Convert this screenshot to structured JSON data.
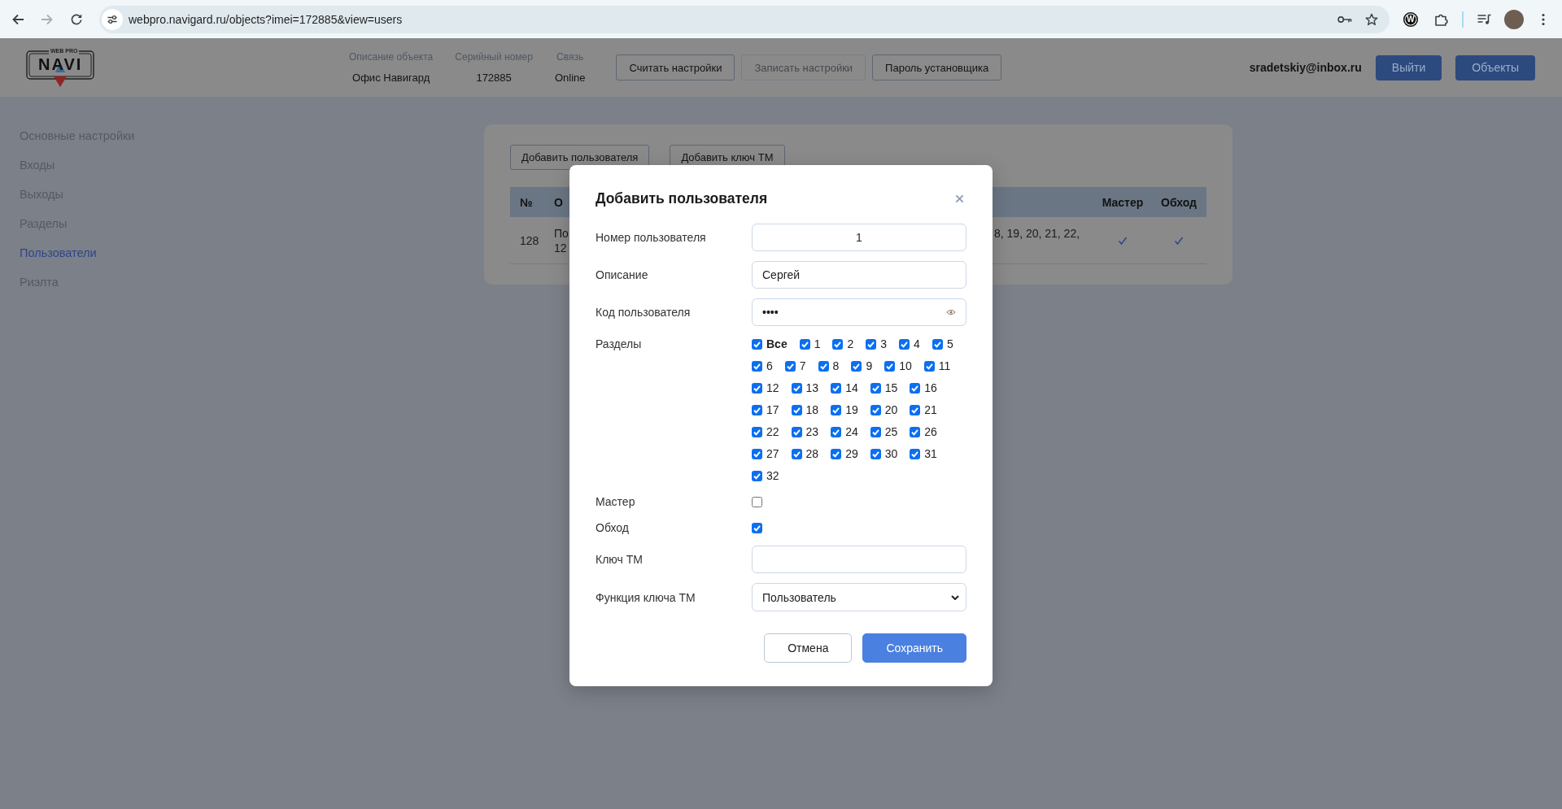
{
  "browser": {
    "url": "webpro.navigard.ru/objects?imei=172885&view=users",
    "forward_disabled": true,
    "extension_letter": "W"
  },
  "header": {
    "logo": {
      "caption": "WEB PRO",
      "wordmark": "NAVI"
    },
    "info": [
      {
        "label": "Описание объекта",
        "value": "Офис Навигард"
      },
      {
        "label": "Серийный номер",
        "value": "172885"
      },
      {
        "label": "Связь",
        "value": "Online"
      }
    ],
    "actions": [
      {
        "label": "Считать настройки",
        "disabled": false
      },
      {
        "label": "Записать настройки",
        "disabled": true
      },
      {
        "label": "Пароль установщика",
        "disabled": false
      }
    ],
    "user_email": "sradetskiy@inbox.ru",
    "buttons": [
      "Выйти",
      "Объекты"
    ]
  },
  "sidebar": {
    "items": [
      {
        "label": "Основные настройки",
        "selected": false
      },
      {
        "label": "Входы",
        "selected": false
      },
      {
        "label": "Выходы",
        "selected": false
      },
      {
        "label": "Разделы",
        "selected": false
      },
      {
        "label": "Пользователи",
        "selected": true
      },
      {
        "label": "Риэлта",
        "selected": false
      }
    ]
  },
  "users_panel": {
    "buttons": [
      "Добавить пользователя",
      "Добавить ключ ТМ"
    ],
    "table": {
      "columns": [
        "№",
        "О",
        "Мастер",
        "Обход"
      ],
      "rows": [
        {
          "number": "128",
          "description": "По\n12",
          "partitions": "8, 19, 20, 21, 22,",
          "master": true,
          "bypass": true
        }
      ]
    }
  },
  "dialog": {
    "title": "Добавить пользователя",
    "fields": [
      {
        "kind": "number",
        "label": "Номер пользователя",
        "value": "1"
      },
      {
        "kind": "text",
        "label": "Описание",
        "value": "Сергей"
      },
      {
        "kind": "password",
        "label": "Код пользователя",
        "value": "••••"
      },
      {
        "kind": "partitions",
        "label": "Разделы",
        "all": {
          "label": "Все",
          "checked": true
        },
        "items": [
          {
            "label": "1",
            "checked": true
          },
          {
            "label": "2",
            "checked": true
          },
          {
            "label": "3",
            "checked": true
          },
          {
            "label": "4",
            "checked": true
          },
          {
            "label": "5",
            "checked": true
          },
          {
            "label": "6",
            "checked": true
          },
          {
            "label": "7",
            "checked": true
          },
          {
            "label": "8",
            "checked": true
          },
          {
            "label": "9",
            "checked": true
          },
          {
            "label": "10",
            "checked": true
          },
          {
            "label": "11",
            "checked": true
          },
          {
            "label": "12",
            "checked": true
          },
          {
            "label": "13",
            "checked": true
          },
          {
            "label": "14",
            "checked": true
          },
          {
            "label": "15",
            "checked": true
          },
          {
            "label": "16",
            "checked": true
          },
          {
            "label": "17",
            "checked": true
          },
          {
            "label": "18",
            "checked": true
          },
          {
            "label": "19",
            "checked": true
          },
          {
            "label": "20",
            "checked": true
          },
          {
            "label": "21",
            "checked": true
          },
          {
            "label": "22",
            "checked": true
          },
          {
            "label": "23",
            "checked": true
          },
          {
            "label": "24",
            "checked": true
          },
          {
            "label": "25",
            "checked": true
          },
          {
            "label": "26",
            "checked": true
          },
          {
            "label": "27",
            "checked": true
          },
          {
            "label": "28",
            "checked": true
          },
          {
            "label": "29",
            "checked": true
          },
          {
            "label": "30",
            "checked": true
          },
          {
            "label": "31",
            "checked": true
          },
          {
            "label": "32",
            "checked": true
          }
        ]
      },
      {
        "kind": "checkbox",
        "label": "Мастер",
        "checked": false
      },
      {
        "kind": "checkbox",
        "label": "Обход",
        "checked": true
      },
      {
        "kind": "text",
        "label": "Ключ ТМ"
      },
      {
        "kind": "select",
        "label": "Функция ключа ТМ",
        "value": "Пользователь"
      }
    ],
    "buttons": [
      {
        "label": "Отмена",
        "kind": "secondary"
      },
      {
        "label": "Сохранить",
        "kind": "primary"
      }
    ]
  }
}
